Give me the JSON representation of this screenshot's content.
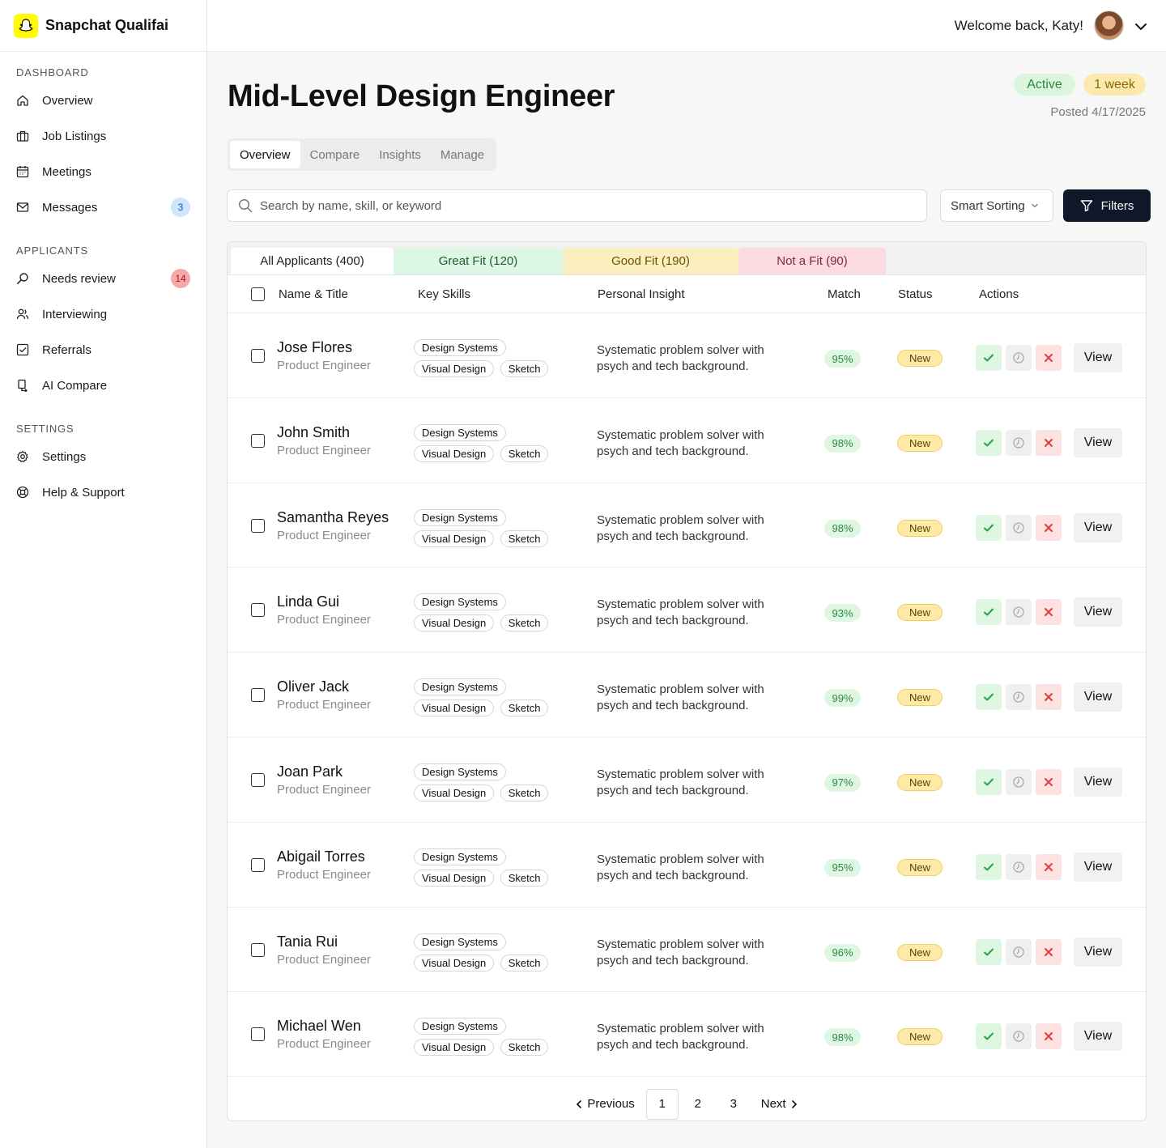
{
  "brand": {
    "name": "Snapchat Qualifai"
  },
  "header": {
    "welcome": "Welcome back, Katy!"
  },
  "sidebar": {
    "sections": [
      {
        "title": "DASHBOARD",
        "items": [
          {
            "label": "Overview",
            "icon": "home-icon"
          },
          {
            "label": "Job Listings",
            "icon": "briefcase-icon"
          },
          {
            "label": "Meetings",
            "icon": "calendar-icon"
          },
          {
            "label": "Messages",
            "icon": "mail-icon",
            "badge": "3",
            "badge_color": "blue"
          }
        ]
      },
      {
        "title": "APPLICANTS",
        "items": [
          {
            "label": "Needs review",
            "icon": "search-icon",
            "badge": "14",
            "badge_color": "red"
          },
          {
            "label": "Interviewing",
            "icon": "users-icon"
          },
          {
            "label": "Referrals",
            "icon": "checkbox-icon"
          },
          {
            "label": "AI Compare",
            "icon": "compare-icon"
          }
        ]
      },
      {
        "title": "SETTINGS",
        "items": [
          {
            "label": "Settings",
            "icon": "gear-icon"
          },
          {
            "label": "Help & Support",
            "icon": "lifebuoy-icon"
          }
        ]
      }
    ]
  },
  "job": {
    "title": "Mid-Level Design Engineer",
    "status": "Active",
    "duration": "1 week",
    "posted": "Posted 4/17/2025"
  },
  "tabs": [
    "Overview",
    "Compare",
    "Insights",
    "Manage"
  ],
  "search": {
    "placeholder": "Search by name, skill, or keyword"
  },
  "sort_label": "Smart Sorting",
  "filters_label": "Filters",
  "fit_tabs": [
    "All Applicants (400)",
    "Great Fit (120)",
    "Good Fit (190)",
    "Not a Fit (90)"
  ],
  "columns": [
    "Name & Title",
    "Key Skills",
    "Personal Insight",
    "Match",
    "Status",
    "Actions"
  ],
  "candidates": [
    {
      "name": "Jose Flores",
      "title": "Product Engineer",
      "skills": [
        "Design Systems",
        "Visual Design",
        "Sketch"
      ],
      "insight": [
        "Systematic problem solver with",
        "psych and tech background."
      ],
      "match": "95%",
      "status": "New",
      "view": "View"
    },
    {
      "name": "John Smith",
      "title": "Product Engineer",
      "skills": [
        "Design Systems",
        "Visual Design",
        "Sketch"
      ],
      "insight": [
        "Systematic problem solver with",
        "psych and tech background."
      ],
      "match": "98%",
      "status": "New",
      "view": "View"
    },
    {
      "name": "Samantha Reyes",
      "title": "Product Engineer",
      "skills": [
        "Design Systems",
        "Visual Design",
        "Sketch"
      ],
      "insight": [
        "Systematic problem solver with",
        "psych and tech background."
      ],
      "match": "98%",
      "status": "New",
      "view": "View"
    },
    {
      "name": "Linda Gui",
      "title": "Product Engineer",
      "skills": [
        "Design Systems",
        "Visual Design",
        "Sketch"
      ],
      "insight": [
        "Systematic problem solver with",
        "psych and tech background."
      ],
      "match": "93%",
      "status": "New",
      "view": "View"
    },
    {
      "name": "Oliver Jack",
      "title": "Product Engineer",
      "skills": [
        "Design Systems",
        "Visual Design",
        "Sketch"
      ],
      "insight": [
        "Systematic problem solver with",
        "psych and tech background."
      ],
      "match": "99%",
      "status": "New",
      "view": "View"
    },
    {
      "name": "Joan Park",
      "title": "Product Engineer",
      "skills": [
        "Design Systems",
        "Visual Design",
        "Sketch"
      ],
      "insight": [
        "Systematic problem solver with",
        "psych and tech background."
      ],
      "match": "97%",
      "status": "New",
      "view": "View"
    },
    {
      "name": "Abigail Torres",
      "title": "Product Engineer",
      "skills": [
        "Design Systems",
        "Visual Design",
        "Sketch"
      ],
      "insight": [
        "Systematic problem solver with",
        "psych and tech background."
      ],
      "match": "95%",
      "status": "New",
      "view": "View"
    },
    {
      "name": "Tania Rui",
      "title": "Product Engineer",
      "skills": [
        "Design Systems",
        "Visual Design",
        "Sketch"
      ],
      "insight": [
        "Systematic problem solver with",
        "psych and tech background."
      ],
      "match": "96%",
      "status": "New",
      "view": "View"
    },
    {
      "name": "Michael  Wen",
      "title": "Product Engineer",
      "skills": [
        "Design Systems",
        "Visual Design",
        "Sketch"
      ],
      "insight": [
        "Systematic problem solver with",
        "psych and tech background."
      ],
      "match": "98%",
      "status": "New",
      "view": "View"
    }
  ],
  "pagination": {
    "previous": "Previous",
    "next": "Next",
    "pages": [
      "1",
      "2",
      "3"
    ],
    "current": "1"
  },
  "colors": {
    "brand": "#fffc00",
    "primary_button": "#0f1729",
    "great": "#dcf7e3",
    "good": "#fcefbf",
    "not": "#fcdbe0"
  }
}
